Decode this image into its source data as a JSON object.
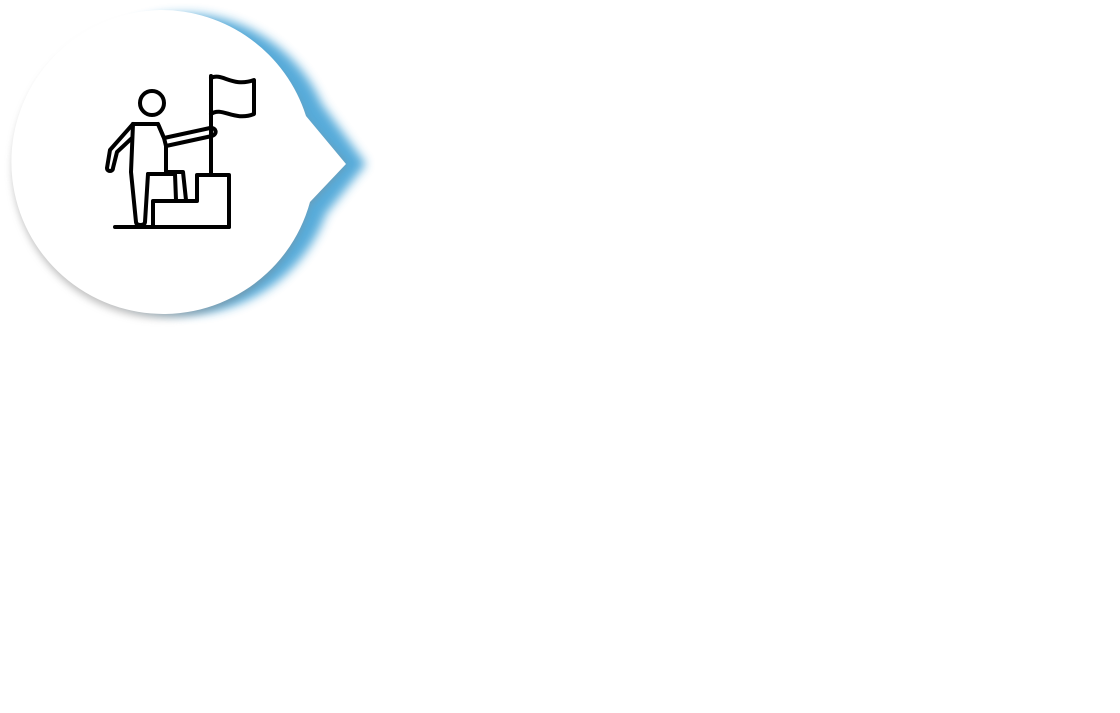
{
  "badge": {
    "icon": "person-climbing-steps-with-flag-icon",
    "colors": {
      "bubble_fill": "#ffffff",
      "accent_glow": "#4fa7d8",
      "drop_shadow": "#8a8a8a",
      "icon_stroke": "#000000"
    }
  }
}
